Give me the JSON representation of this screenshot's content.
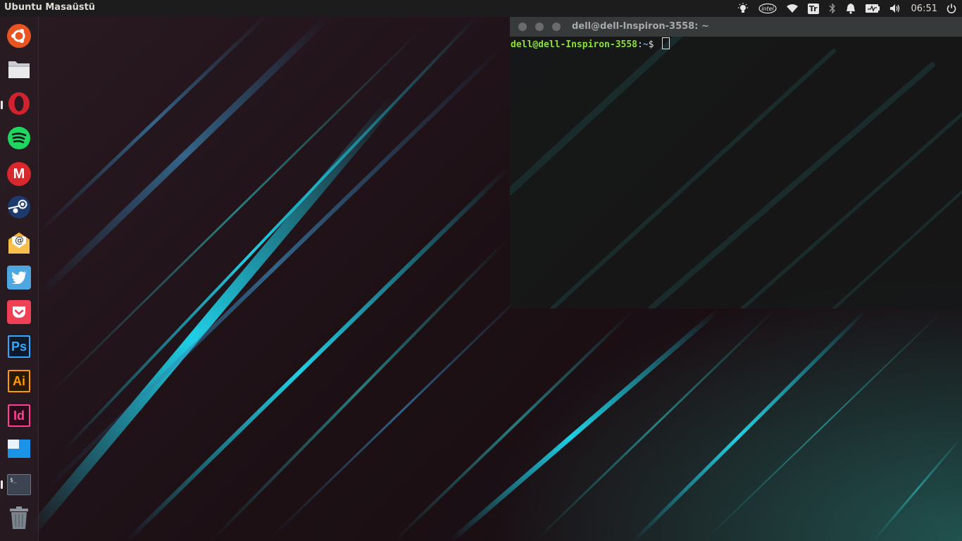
{
  "top_panel": {
    "app_title": "Ubuntu Masaüstü",
    "clock": "06:51",
    "indicators": [
      {
        "name": "brightness-icon"
      },
      {
        "name": "intel-icon",
        "text": "intel"
      },
      {
        "name": "wifi-icon"
      },
      {
        "name": "keyboard-layout-icon",
        "text": "Tr"
      },
      {
        "name": "bluetooth-icon"
      },
      {
        "name": "notification-bell-icon"
      },
      {
        "name": "battery-icon"
      },
      {
        "name": "volume-icon"
      },
      {
        "name": "power-icon"
      }
    ]
  },
  "launcher": {
    "items": [
      {
        "name": "ubuntu-dash",
        "icon": "ubuntu-logo-icon",
        "running": false
      },
      {
        "name": "files",
        "icon": "folder-icon",
        "running": false
      },
      {
        "name": "opera",
        "icon": "opera-icon",
        "running": true
      },
      {
        "name": "spotify",
        "icon": "spotify-icon",
        "running": false
      },
      {
        "name": "mega",
        "icon": "mega-icon",
        "text": "M",
        "running": false
      },
      {
        "name": "steam",
        "icon": "steam-icon",
        "running": false
      },
      {
        "name": "mail",
        "icon": "mail-icon",
        "text": "@",
        "running": false
      },
      {
        "name": "twitter",
        "icon": "twitter-icon",
        "running": false
      },
      {
        "name": "pocket",
        "icon": "pocket-icon",
        "running": false
      },
      {
        "name": "photoshop",
        "icon": "photoshop-icon",
        "text": "Ps",
        "running": false
      },
      {
        "name": "illustrator",
        "icon": "illustrator-icon",
        "text": "Ai",
        "running": false
      },
      {
        "name": "indesign",
        "icon": "indesign-icon",
        "text": "Id",
        "running": false
      },
      {
        "name": "workspace-switcher",
        "icon": "workspace-icon",
        "running": false
      },
      {
        "name": "terminal",
        "icon": "terminal-icon",
        "text": "$_",
        "running": true
      },
      {
        "name": "trash",
        "icon": "trash-icon",
        "running": false
      }
    ]
  },
  "terminal": {
    "title": "dell@dell-Inspiron-3558: ~",
    "prompt_user": "dell@dell-Inspiron-3558",
    "prompt_colon": ":",
    "prompt_path": "~",
    "prompt_symbol": "$ "
  },
  "colors": {
    "panel_bg": "#1d1c1d",
    "prompt_user": "#8ae234",
    "prompt_path": "#729fcf",
    "accent_cyan": "#2ed3ea",
    "ubuntu_orange": "#e95420"
  }
}
